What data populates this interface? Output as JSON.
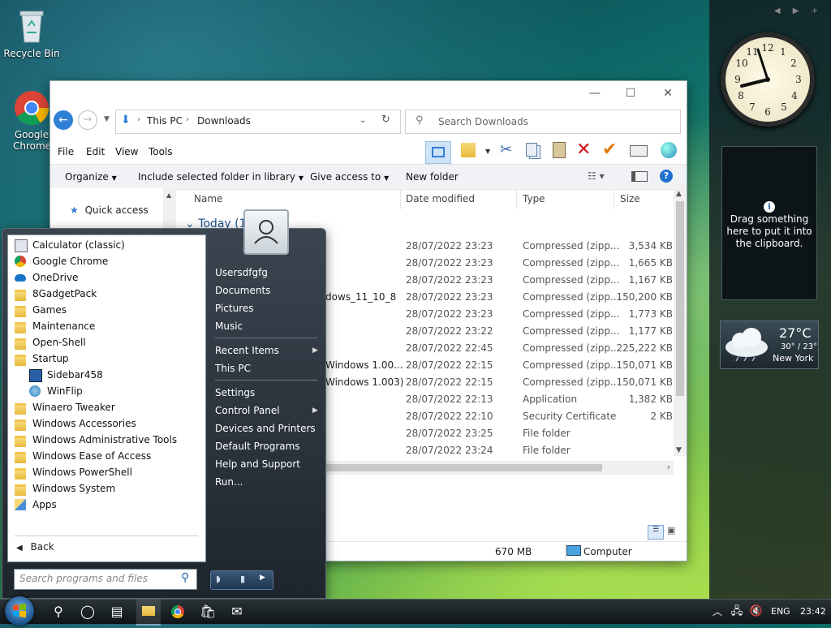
{
  "desktop": {
    "icons": [
      {
        "label": "Recycle Bin"
      },
      {
        "label": "Google Chrome"
      }
    ]
  },
  "explorer": {
    "address": {
      "root": "This PC",
      "folder": "Downloads"
    },
    "search_placeholder": "Search Downloads",
    "menu": [
      "File",
      "Edit",
      "View",
      "Tools"
    ],
    "commands": {
      "organize": "Organize",
      "include": "Include selected folder in library",
      "give_access": "Give access to",
      "new_folder": "New folder"
    },
    "nav": {
      "quick_access": "Quick access"
    },
    "columns": {
      "name": "Name",
      "date": "Date modified",
      "type": "Type",
      "size": "Size"
    },
    "group_header": "Today (1",
    "partial_names": [
      "dows_11_10_8",
      "Windows 1.00...",
      "Windows 1.003)"
    ],
    "rows": [
      {
        "date": "28/07/2022 23:23",
        "type": "Compressed (zipp...",
        "size": "3,534 KB"
      },
      {
        "date": "28/07/2022 23:23",
        "type": "Compressed (zipp...",
        "size": "1,665 KB"
      },
      {
        "date": "28/07/2022 23:23",
        "type": "Compressed (zipp...",
        "size": "1,167 KB"
      },
      {
        "date": "28/07/2022 23:23",
        "type": "Compressed (zipp...",
        "size": "150,200 KB"
      },
      {
        "date": "28/07/2022 23:23",
        "type": "Compressed (zipp...",
        "size": "1,773 KB"
      },
      {
        "date": "28/07/2022 23:22",
        "type": "Compressed (zipp...",
        "size": "1,177 KB"
      },
      {
        "date": "28/07/2022 22:45",
        "type": "Compressed (zipp...",
        "size": "225,222 KB"
      },
      {
        "date": "28/07/2022 22:15",
        "type": "Compressed (zipp...",
        "size": "150,071 KB"
      },
      {
        "date": "28/07/2022 22:15",
        "type": "Compressed (zipp...",
        "size": "150,071 KB"
      },
      {
        "date": "28/07/2022 22:13",
        "type": "Application",
        "size": "1,382 KB"
      },
      {
        "date": "28/07/2022 22:10",
        "type": "Security Certificate",
        "size": "2 KB"
      },
      {
        "date": "28/07/2022 23:25",
        "type": "File folder",
        "size": ""
      },
      {
        "date": "28/07/2022 23:24",
        "type": "File folder",
        "size": ""
      }
    ],
    "status": {
      "size": "670 MB",
      "location": "Computer"
    }
  },
  "start_menu": {
    "programs": [
      {
        "label": "Calculator (classic)",
        "icon": "calculator-icon",
        "indent": false
      },
      {
        "label": "Google Chrome",
        "icon": "chrome-icon",
        "indent": false
      },
      {
        "label": "OneDrive",
        "icon": "cloud-icon",
        "indent": false
      },
      {
        "label": "8GadgetPack",
        "icon": "folder-icon",
        "indent": false
      },
      {
        "label": "Games",
        "icon": "folder-icon",
        "indent": false
      },
      {
        "label": "Maintenance",
        "icon": "folder-icon",
        "indent": false
      },
      {
        "label": "Open-Shell",
        "icon": "folder-icon",
        "indent": false
      },
      {
        "label": "Startup",
        "icon": "folder-icon",
        "indent": false
      },
      {
        "label": "Sidebar458",
        "icon": "sidebar-icon",
        "indent": true
      },
      {
        "label": "WinFlip",
        "icon": "winflip-icon",
        "indent": true
      },
      {
        "label": "Winaero Tweaker",
        "icon": "folder-icon",
        "indent": false
      },
      {
        "label": "Windows Accessories",
        "icon": "folder-icon",
        "indent": false
      },
      {
        "label": "Windows Administrative Tools",
        "icon": "folder-icon",
        "indent": false
      },
      {
        "label": "Windows Ease of Access",
        "icon": "folder-icon",
        "indent": false
      },
      {
        "label": "Windows PowerShell",
        "icon": "folder-icon",
        "indent": false
      },
      {
        "label": "Windows System",
        "icon": "folder-icon",
        "indent": false
      },
      {
        "label": "Apps",
        "icon": "apps-icon",
        "indent": false
      }
    ],
    "back": "Back",
    "search_placeholder": "Search programs and files",
    "right": {
      "user": "Usersdfgfg",
      "documents": "Documents",
      "pictures": "Pictures",
      "music": "Music",
      "recent": "Recent Items",
      "this_pc": "This PC",
      "settings": "Settings",
      "control_panel": "Control Panel",
      "devices": "Devices and Printers",
      "default_programs": "Default Programs",
      "help": "Help and Support",
      "run": "Run..."
    }
  },
  "gadgets": {
    "clipboard": "Drag something here to put it into the clipboard.",
    "weather": {
      "temp": "27°C",
      "range": "30° / 23°",
      "city": "New York"
    }
  },
  "taskbar": {
    "lang": "ENG",
    "time": "23:42"
  }
}
